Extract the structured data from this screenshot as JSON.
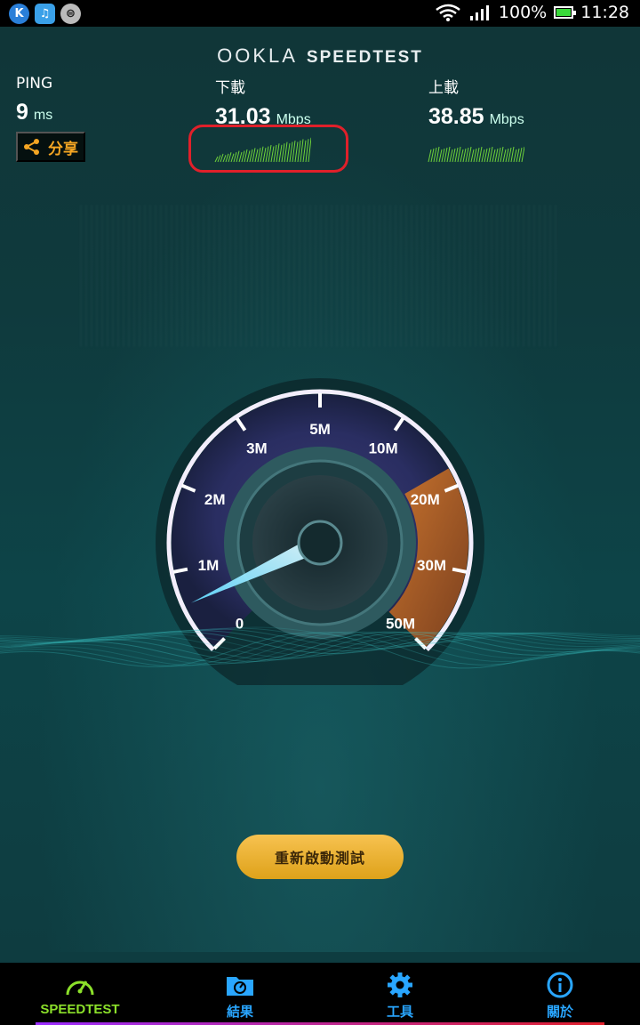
{
  "statusbar": {
    "apps": [
      "K",
      "♫",
      "⊜"
    ],
    "battery": "100%",
    "time": "11:28",
    "battery_level": 1.0
  },
  "header": {
    "brand": "OOKLA",
    "product": "SPEEDTEST"
  },
  "ping": {
    "label": "PING",
    "value": "9",
    "unit": "ms"
  },
  "download": {
    "label": "下載",
    "value": "31.03",
    "unit": "Mbps"
  },
  "upload": {
    "label": "上載",
    "value": "38.85",
    "unit": "Mbps"
  },
  "share_label": "分享",
  "gauge": {
    "ticks": [
      "0",
      "1M",
      "2M",
      "3M",
      "5M",
      "10M",
      "20M",
      "30M",
      "50M"
    ],
    "needle_value": "0"
  },
  "restart_label": "重新啟動測試",
  "nav": {
    "items": [
      {
        "label": "SPEEDTEST",
        "icon": "speedometer-icon"
      },
      {
        "label": "結果",
        "icon": "results-folder-icon"
      },
      {
        "label": "工具",
        "icon": "gear-icon"
      },
      {
        "label": "關於",
        "icon": "info-icon"
      }
    ]
  },
  "colors": {
    "accent_green": "#8be02a",
    "nav_blue": "#29a6ff",
    "button_gold": "#f0b83a",
    "highlight_red": "#e0202a"
  }
}
